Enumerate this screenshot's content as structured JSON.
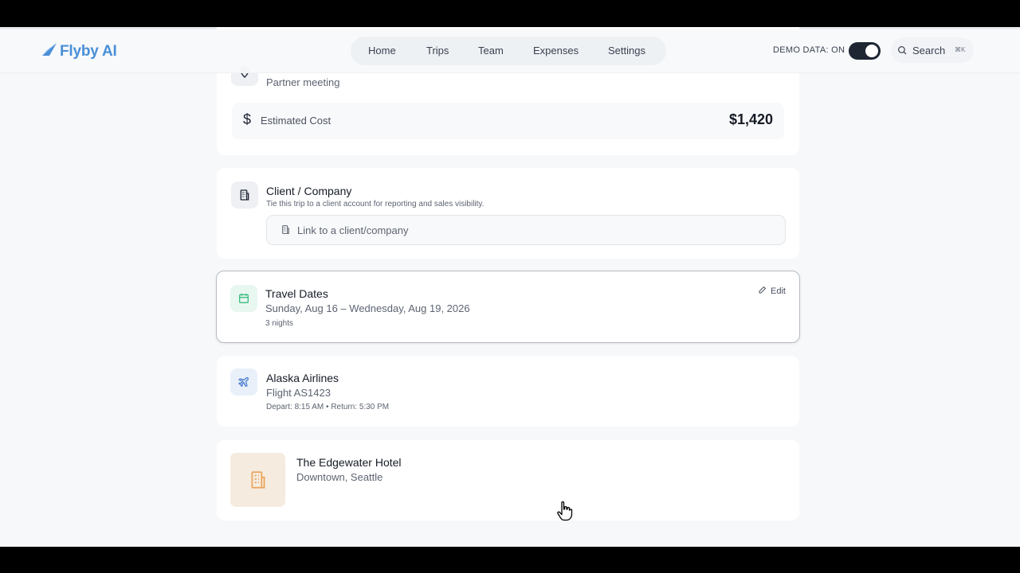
{
  "header": {
    "brand": "Flyby AI",
    "nav": [
      "Home",
      "Trips",
      "Team",
      "Expenses",
      "Settings"
    ],
    "demo_label": "DEMO DATA: ON",
    "demo_on": true,
    "search_label": "Search",
    "search_shortcut": "⌘K"
  },
  "purpose_card": {
    "subtitle": "Partner meeting",
    "cost_label": "Estimated Cost",
    "cost_value": "$1,420"
  },
  "client_card": {
    "title": "Client / Company",
    "description": "Tie this trip to a client account for reporting and sales visibility.",
    "link_placeholder": "Link to a client/company"
  },
  "dates_card": {
    "title": "Travel Dates",
    "range": "Sunday, Aug 16 – Wednesday, Aug 19, 2026",
    "nights": "3 nights",
    "edit_label": "Edit"
  },
  "flight_card": {
    "airline": "Alaska Airlines",
    "flight": "Flight AS1423",
    "times": "Depart: 8:15 AM • Return: 5:30 PM"
  },
  "hotel_card": {
    "name": "The Edgewater Hotel",
    "location": "Downtown, Seattle"
  },
  "colors": {
    "brand": "#4a8fd8",
    "calendar_green": "#3dbb83",
    "plane_blue": "#4a7fd0",
    "hotel_orange": "#e9a55a"
  }
}
